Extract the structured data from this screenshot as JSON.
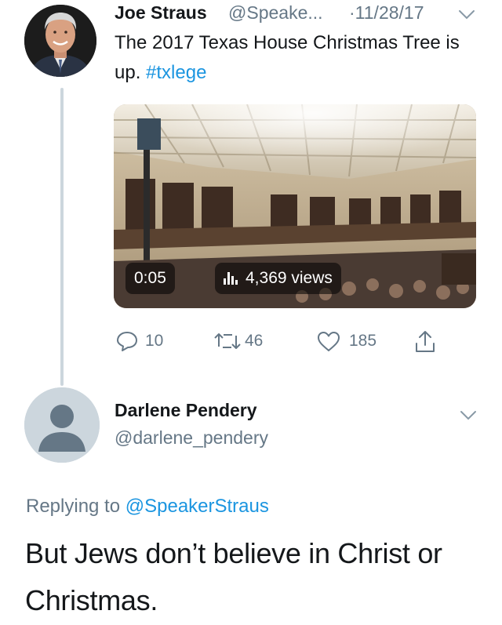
{
  "tweet": {
    "author_name": "Joe Straus",
    "author_handle": "@Speake...",
    "date_separator": "·",
    "date": "11/28/17",
    "text": "The 2017 Texas House Christmas Tree is up. ",
    "hashtag": "#txlege",
    "video": {
      "duration": "0:05",
      "views": "4,369 views"
    },
    "actions": {
      "replies": "10",
      "retweets": "46",
      "likes": "185"
    },
    "colors": {
      "link": "#1b95e0",
      "muted": "#657786",
      "thread_line": "#ccd6dd"
    }
  },
  "reply": {
    "author_name": "Darlene Pendery",
    "author_handle": "@darlene_pendery",
    "replying_prefix": "Replying to ",
    "replying_to": "@SpeakerStraus",
    "text": "But Jews don’t believe in Christ or Christmas."
  },
  "icons": [
    "chevron-down-icon",
    "reply-icon",
    "retweet-icon",
    "like-icon",
    "share-icon",
    "volume-bars-icon"
  ]
}
